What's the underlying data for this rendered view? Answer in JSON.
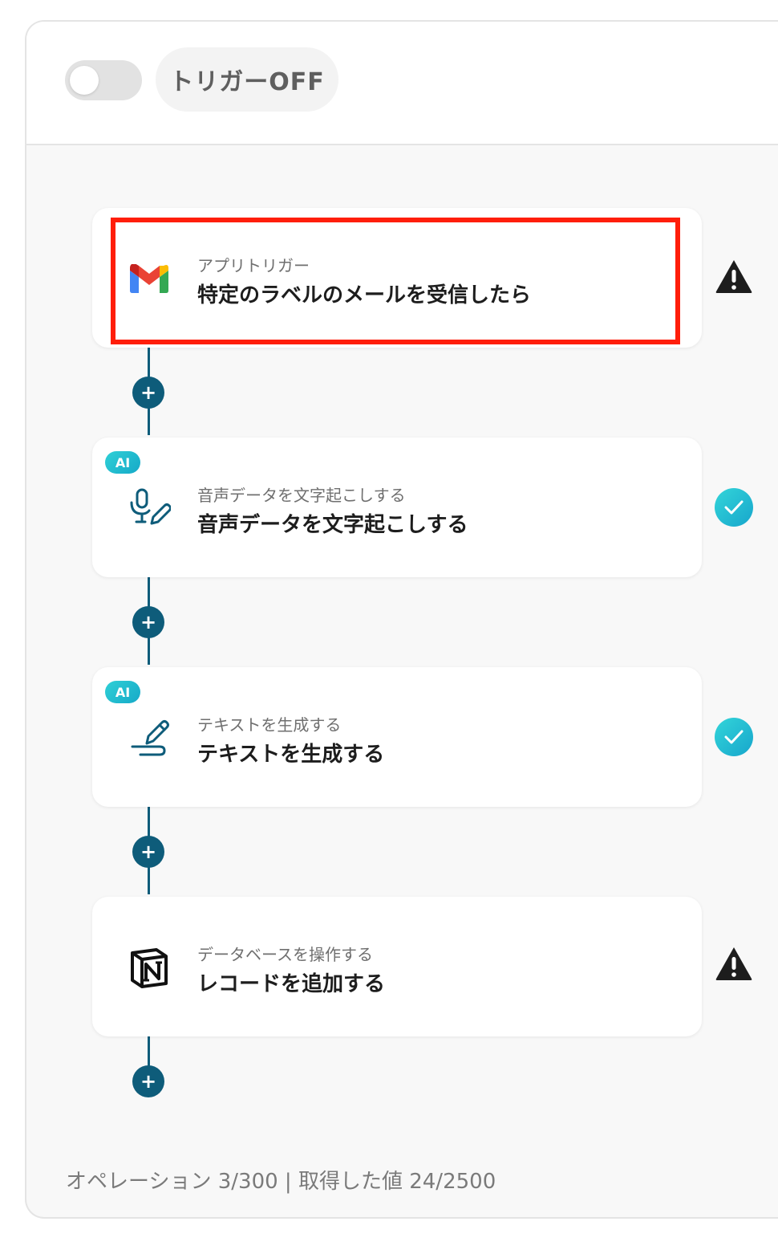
{
  "header": {
    "toggle_state": "off",
    "trigger_label": "トリガーOFF"
  },
  "steps": [
    {
      "icon": "gmail-icon",
      "subtitle": "アプリトリガー",
      "title": "特定のラベルのメールを受信したら",
      "status": "warning",
      "ai": false
    },
    {
      "icon": "microphone-pen-icon",
      "subtitle": "音声データを文字起こしする",
      "title": "音声データを文字起こしする",
      "status": "done",
      "ai": true,
      "badge": "AI"
    },
    {
      "icon": "pen-signature-icon",
      "subtitle": "テキストを生成する",
      "title": "テキストを生成する",
      "status": "done",
      "ai": true,
      "badge": "AI"
    },
    {
      "icon": "notion-icon",
      "subtitle": "データベースを操作する",
      "title": "レコードを追加する",
      "status": "warning",
      "ai": false
    }
  ],
  "footer": {
    "text": "オペレーション 3/300 | 取得した値 24/2500"
  },
  "colors": {
    "accent": "#0e5c7a",
    "ai_badge": "#1fbfd0",
    "highlight": "#ff1e0a",
    "warning": "#1d1d1d"
  }
}
